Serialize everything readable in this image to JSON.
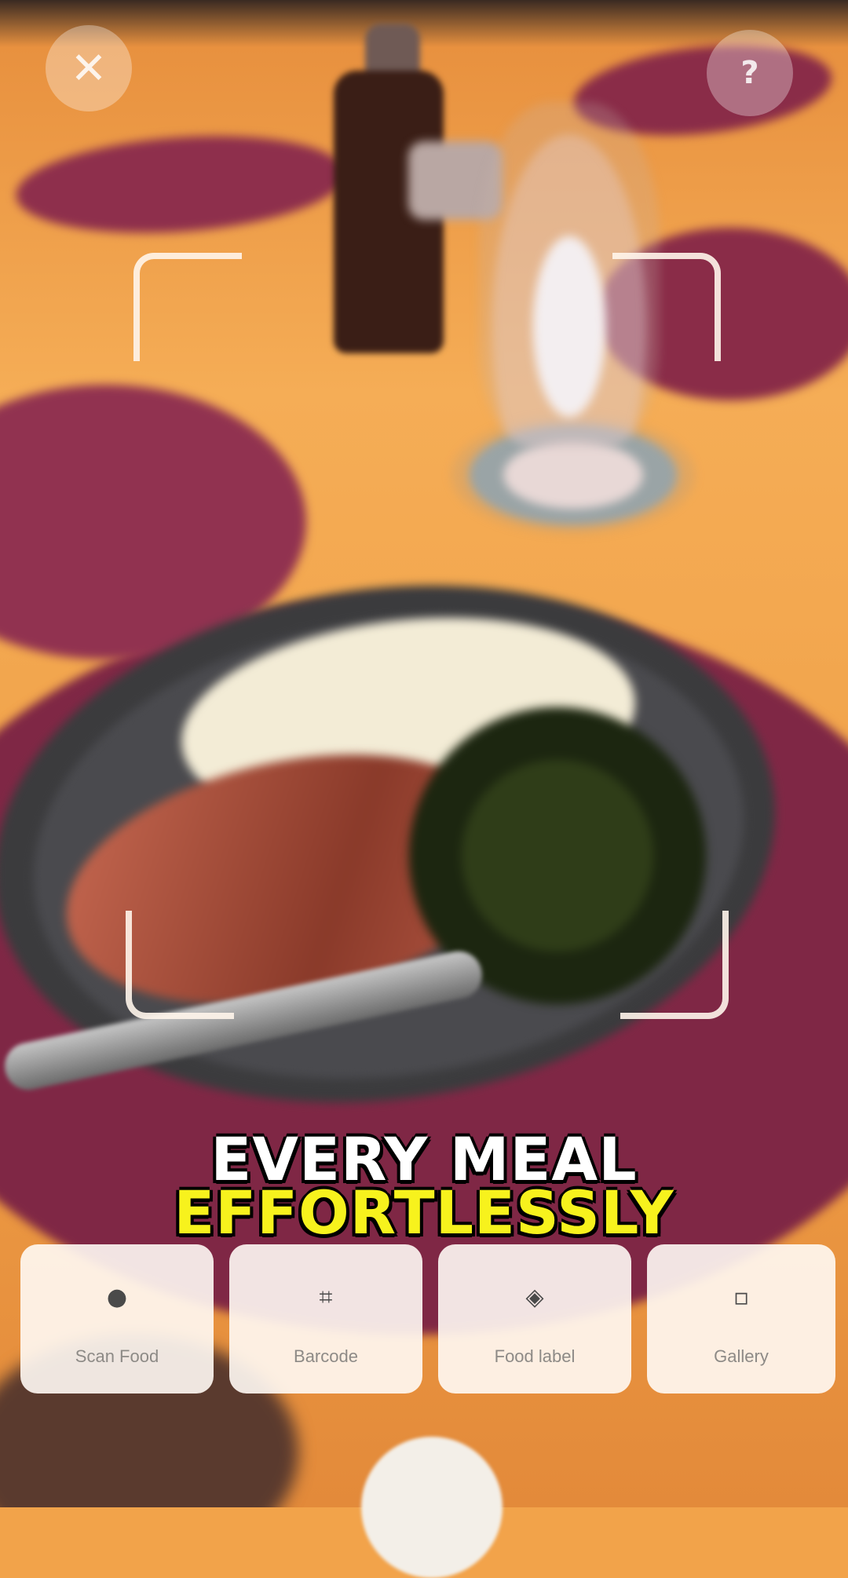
{
  "controls": {
    "close_glyph": "✕",
    "help_glyph": "?"
  },
  "caption": {
    "line1": "EVERY MEAL",
    "line2": "EFFORTLESSLY"
  },
  "modes": [
    {
      "label": "Scan Food",
      "icon": "camera-dot-icon",
      "glyph": "●"
    },
    {
      "label": "Barcode",
      "icon": "barcode-icon",
      "glyph": "⌗"
    },
    {
      "label": "Food label",
      "icon": "tag-icon",
      "glyph": "◈"
    },
    {
      "label": "Gallery",
      "icon": "image-icon",
      "glyph": "▫"
    }
  ],
  "colors": {
    "caption_primary": "#ffffff",
    "caption_accent": "#f7f21d"
  }
}
